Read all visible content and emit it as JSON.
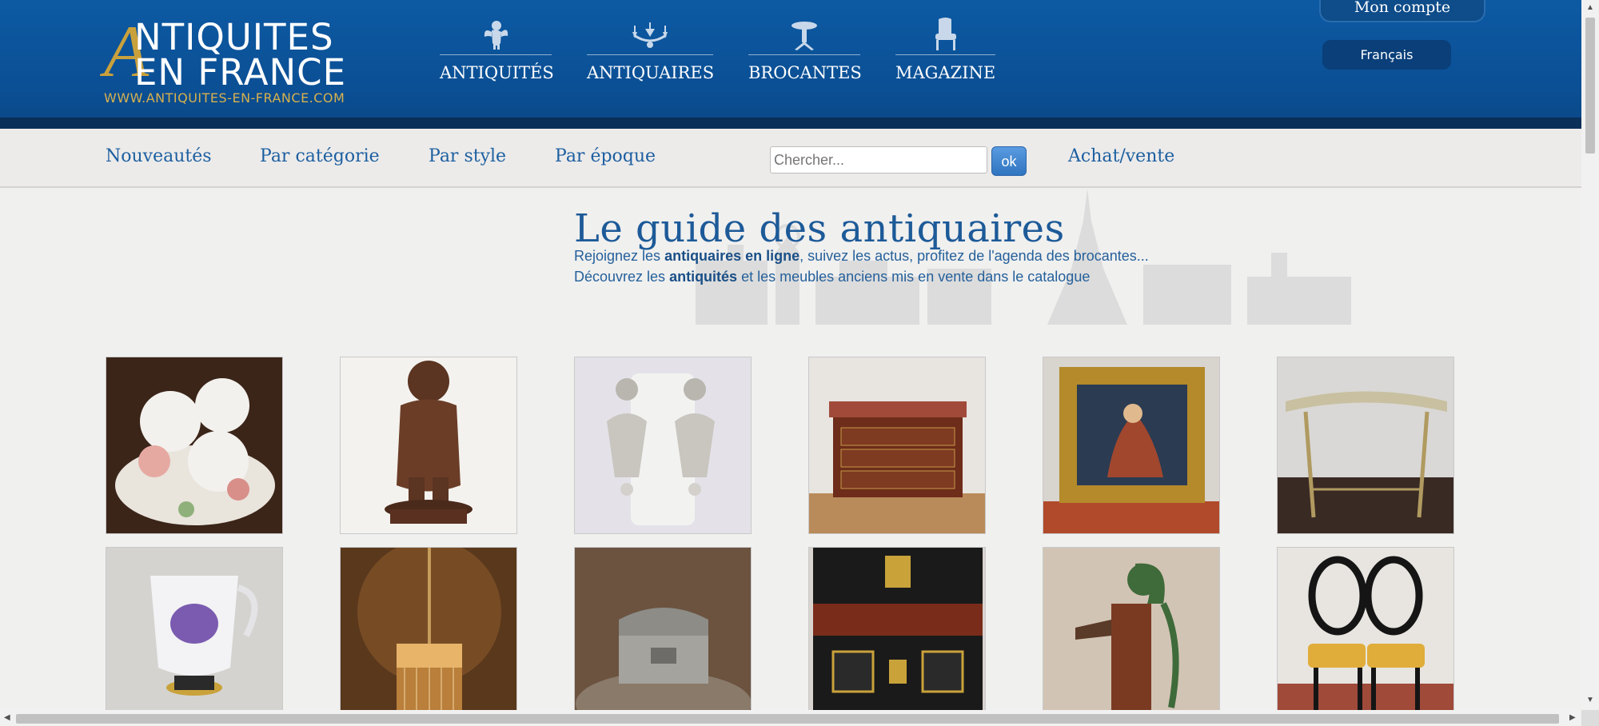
{
  "header": {
    "logo_initial": "A",
    "logo_line1": "NTIQUITES",
    "logo_line2": "EN FRANCE",
    "logo_url": "WWW.ANTIQUITES-EN-FRANCE.COM",
    "nav": [
      {
        "label": "ANTIQUITÉS",
        "icon": "cherub-icon"
      },
      {
        "label": "ANTIQUAIRES",
        "icon": "chandelier-icon"
      },
      {
        "label": "BROCANTES",
        "icon": "gueridon-icon"
      },
      {
        "label": "MAGAZINE",
        "icon": "armchair-icon"
      }
    ],
    "account_label": "Mon compte",
    "language_label": "Français"
  },
  "subnav": {
    "links": [
      "Nouveautés",
      "Par catégorie",
      "Par style",
      "Par époque"
    ],
    "search_placeholder": "Chercher...",
    "search_button": "ok",
    "buy_sell": "Achat/vente"
  },
  "hero": {
    "title": "Le guide des antiquaires",
    "line1_pre": "Rejoignez les ",
    "line1_bold": "antiquaires en ligne",
    "line1_post": ", suivez les actus, profitez de l'agenda des brocantes...",
    "line2_pre": "Découvrez les ",
    "line2_bold": "antiquités",
    "line2_post": " et les meubles anciens mis en vente dans le catalogue"
  },
  "catalog": {
    "items": [
      {
        "subject": "porcelain-egg-cups-with-cherubs"
      },
      {
        "subject": "bronze-boy-statue"
      },
      {
        "subject": "crystal-chandelier-earrings"
      },
      {
        "subject": "louis-xv-marble-top-commode"
      },
      {
        "subject": "gilt-framed-oil-painting"
      },
      {
        "subject": "half-moon-console-table"
      },
      {
        "subject": "painted-glass-pitcher-violet"
      },
      {
        "subject": "glass-pendant-lamp"
      },
      {
        "subject": "pewter-casket-box"
      },
      {
        "subject": "napoleon-iii-ebonized-cabinet"
      },
      {
        "subject": "cast-iron-water-pump"
      },
      {
        "subject": "pair-of-balloon-back-chairs"
      }
    ]
  },
  "colors": {
    "header_blue": "#0b4f94",
    "header_band": "#0a2f58",
    "gold": "#c9a13c",
    "link_blue": "#1d5fa0",
    "subnav_bg": "#ecebea"
  }
}
